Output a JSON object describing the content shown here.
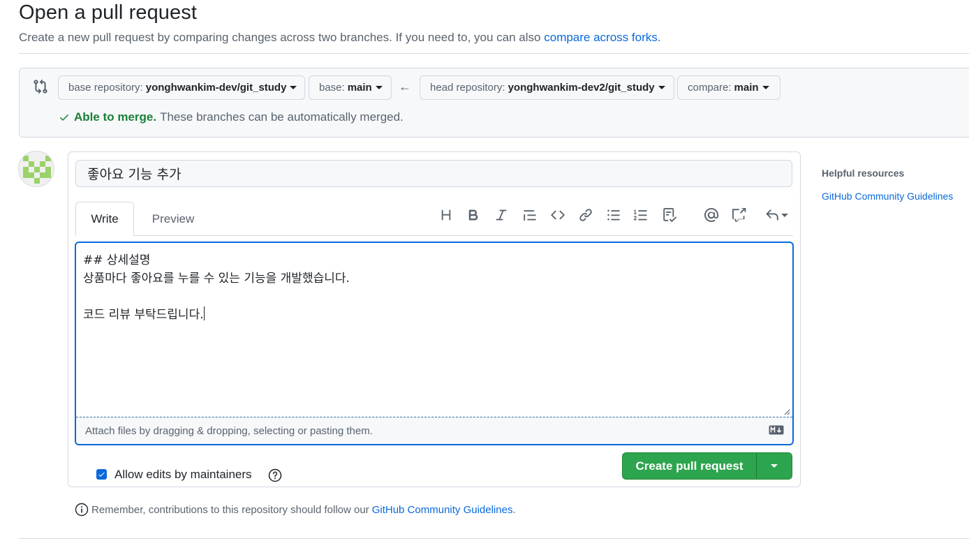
{
  "header": {
    "title": "Open a pull request",
    "subtitle_prefix": "Create a new pull request by comparing changes across two branches. If you need to, you can also",
    "subtitle_link": "compare across forks",
    "subtitle_suffix": "."
  },
  "range": {
    "base_repo_label": "base repository:",
    "base_repo_value": "yonghwankim-dev/git_study",
    "base_label": "base:",
    "base_value": "main",
    "head_repo_label": "head repository:",
    "head_repo_value": "yonghwankim-dev2/git_study",
    "compare_label": "compare:",
    "compare_value": "main",
    "merge_ok": "Able to merge.",
    "merge_text": "These branches can be automatically merged."
  },
  "composer": {
    "title_value": "좋아요 기능 추가",
    "tab_write": "Write",
    "tab_preview": "Preview",
    "body_text": "## 상세설명\n상품마다 좋아요를 누를 수 있는 기능을 개발했습니다.\n\n코드 리뷰 부탁드립니다.",
    "attach_text": "Attach files by dragging & dropping, selecting or pasting them.",
    "allow_edits_label": "Allow edits by maintainers",
    "allow_edits_checked": true,
    "create_button": "Create pull request"
  },
  "toolbar": {
    "icons": [
      "heading-icon",
      "bold-icon",
      "italic-icon",
      "quote-icon",
      "code-icon",
      "link-icon",
      "unordered-list-icon",
      "ordered-list-icon",
      "task-list-icon",
      "mention-icon",
      "reference-icon",
      "reply-icon"
    ]
  },
  "footer": {
    "remember_text": "Remember, contributions to this repository should follow our",
    "remember_link": "GitHub Community Guidelines",
    "remember_suffix": "."
  },
  "sidebar": {
    "title": "Helpful resources",
    "link": "GitHub Community Guidelines"
  },
  "colors": {
    "accent": "#0969da",
    "success": "#1a7f37",
    "button_green": "#2da44e",
    "border": "#d1d9e0",
    "muted": "#59636e"
  }
}
